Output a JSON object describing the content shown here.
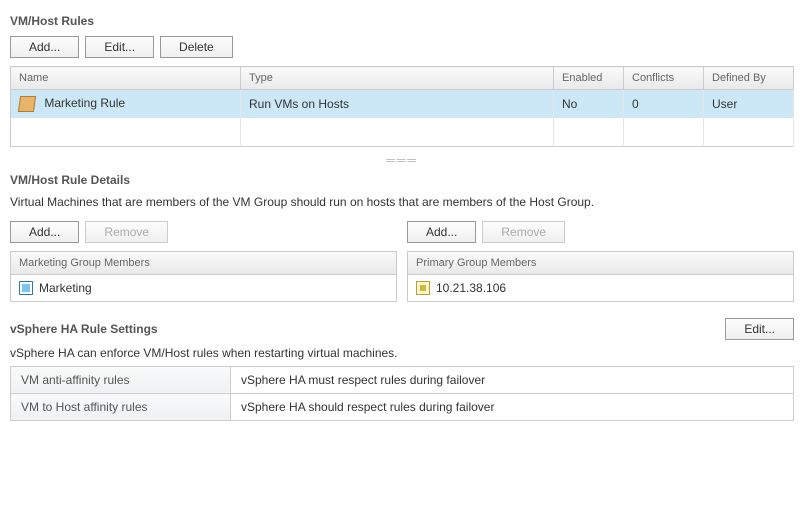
{
  "rulesSection": {
    "title": "VM/Host Rules",
    "buttons": {
      "add": "Add...",
      "edit": "Edit...",
      "delete": "Delete"
    },
    "columns": {
      "name": "Name",
      "type": "Type",
      "enabled": "Enabled",
      "conflicts": "Conflicts",
      "definedBy": "Defined By"
    },
    "row": {
      "name": "Marketing Rule",
      "type": "Run VMs on Hosts",
      "enabled": "No",
      "conflicts": "0",
      "definedBy": "User"
    }
  },
  "detailsSection": {
    "title": "VM/Host Rule Details",
    "description": "Virtual Machines that are members of the VM Group should run on hosts that are members of the Host Group.",
    "left": {
      "add": "Add...",
      "remove": "Remove",
      "header": "Marketing Group Members",
      "item": "Marketing"
    },
    "right": {
      "add": "Add...",
      "remove": "Remove",
      "header": "Primary Group Members",
      "item": "10.21.38.106"
    }
  },
  "haSection": {
    "title": "vSphere HA Rule Settings",
    "edit": "Edit...",
    "description": "vSphere HA can enforce VM/Host rules when restarting virtual machines.",
    "rows": [
      {
        "k": "VM anti-affinity rules",
        "v": "vSphere HA must respect rules during failover"
      },
      {
        "k": "VM to Host affinity rules",
        "v": "vSphere HA should respect rules during failover"
      }
    ]
  }
}
